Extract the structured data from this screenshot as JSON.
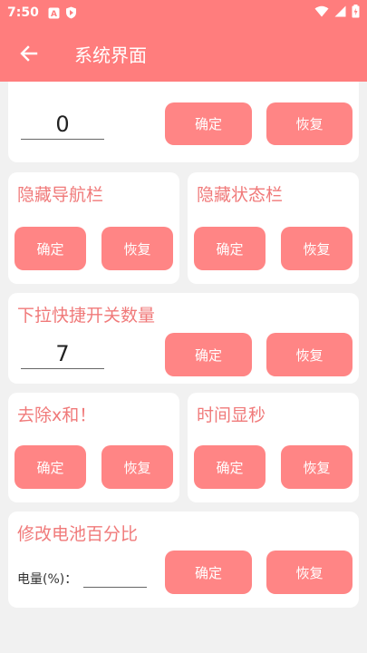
{
  "status_bar": {
    "time": "7:50",
    "icons": [
      "a-icon",
      "shield-icon",
      "wifi-icon",
      "signal-icon",
      "battery-icon"
    ]
  },
  "app_bar": {
    "title": "系统界面",
    "back_icon": "arrow-left-icon"
  },
  "colors": {
    "accent": "#ff7d7d",
    "button": "#ff8585",
    "title_text": "#f07a7a",
    "background": "#f1f1f1"
  },
  "cards": {
    "top": {
      "input_value": "0",
      "confirm": "确定",
      "restore": "恢复"
    },
    "hide_nav": {
      "title": "隐藏导航栏",
      "confirm": "确定",
      "restore": "恢复"
    },
    "hide_status": {
      "title": "隐藏状态栏",
      "confirm": "确定",
      "restore": "恢复"
    },
    "quick_settings": {
      "title": "下拉快捷开关数量",
      "input_value": "7",
      "confirm": "确定",
      "restore": "恢复"
    },
    "remove_x": {
      "title": "去除x和！",
      "confirm": "确定",
      "restore": "恢复"
    },
    "seconds": {
      "title": "时间显秒",
      "confirm": "确定",
      "restore": "恢复"
    },
    "battery": {
      "title": "修改电池百分比",
      "label": "电量(%)：",
      "input_value": "",
      "confirm": "确定",
      "restore": "恢复"
    }
  }
}
